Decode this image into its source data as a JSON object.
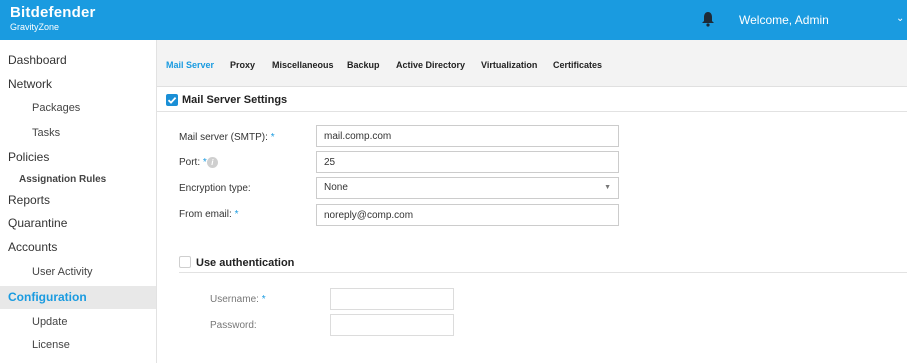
{
  "header": {
    "brand_name": "Bitdefender",
    "brand_sub": "GravityZone",
    "welcome": "Welcome, Admin",
    "bell_icon": "bell-icon",
    "chevron_icon": "chevron-down-icon",
    "color": "#1a9be0"
  },
  "sidebar": {
    "items": [
      {
        "label": "Dashboard"
      },
      {
        "label": "Network"
      },
      {
        "label": "Packages"
      },
      {
        "label": "Tasks"
      },
      {
        "label": "Policies"
      },
      {
        "label": "Assignation Rules"
      },
      {
        "label": "Reports"
      },
      {
        "label": "Quarantine"
      },
      {
        "label": "Accounts"
      },
      {
        "label": "User Activity"
      },
      {
        "label": "Configuration",
        "active": true
      },
      {
        "label": "Update"
      },
      {
        "label": "License"
      }
    ]
  },
  "tabs": [
    {
      "label": "Mail Server",
      "active": true
    },
    {
      "label": "Proxy"
    },
    {
      "label": "Miscellaneous"
    },
    {
      "label": "Backup"
    },
    {
      "label": "Active Directory"
    },
    {
      "label": "Virtualization"
    },
    {
      "label": "Certificates"
    }
  ],
  "mail_settings": {
    "title": "Mail Server Settings",
    "checked": true,
    "fields": {
      "smtp": {
        "label": "Mail server (SMTP):",
        "required": "*",
        "value": "mail.comp.com"
      },
      "port": {
        "label": "Port:",
        "required": "*",
        "value": "25",
        "info_icon": "info-icon"
      },
      "encryption": {
        "label": "Encryption type:",
        "value": "None"
      },
      "from_email": {
        "label": "From email:",
        "required": "*",
        "value": "noreply@comp.com"
      }
    }
  },
  "authentication": {
    "title": "Use authentication",
    "checked": false,
    "username": {
      "label": "Username:",
      "required": "*",
      "value": ""
    },
    "password": {
      "label": "Password:",
      "value": ""
    }
  }
}
